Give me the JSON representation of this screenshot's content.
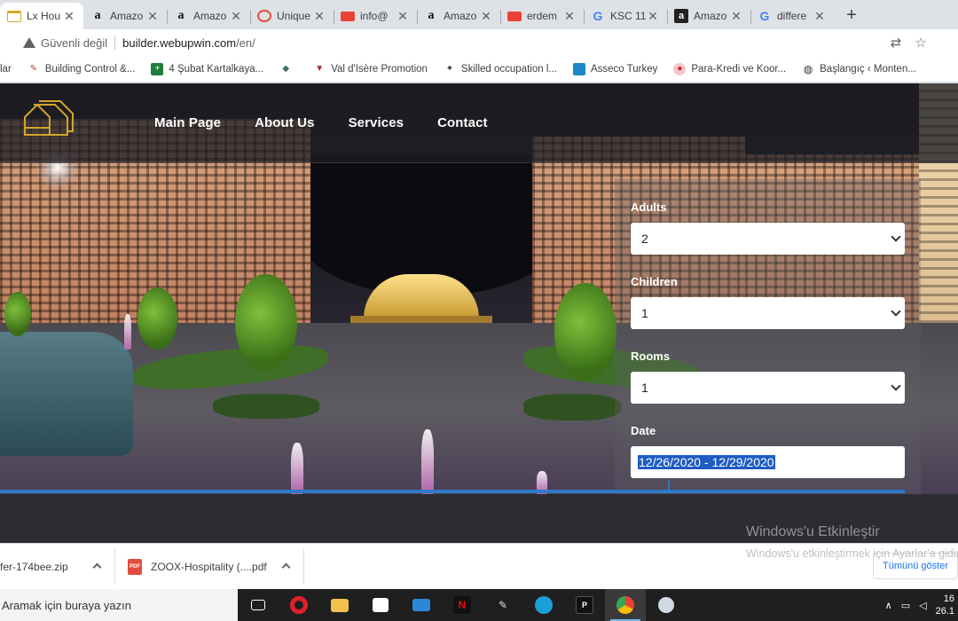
{
  "browser": {
    "tabs": [
      {
        "title": "Lx Hou",
        "icon": "house-icon",
        "active": true
      },
      {
        "title": "Amazo",
        "icon": "amazon-icon"
      },
      {
        "title": "Amazo",
        "icon": "amazon-icon"
      },
      {
        "title": "Unique",
        "icon": "unique-icon"
      },
      {
        "title": "info@",
        "icon": "gmail-icon"
      },
      {
        "title": "Amazo",
        "icon": "amazon-icon"
      },
      {
        "title": "erdem",
        "icon": "gmail-icon"
      },
      {
        "title": "KSC 11",
        "icon": "google-icon"
      },
      {
        "title": "Amazo",
        "icon": "amazon-dark-icon"
      },
      {
        "title": "differe",
        "icon": "google-icon"
      }
    ],
    "new_tab_label": "+",
    "security_label": "Güvenli değil",
    "url_host": "builder.webupwin.com",
    "url_path": "/en/",
    "bookmarks": [
      {
        "label": "lar",
        "icon": ""
      },
      {
        "label": "Building Control &...",
        "icon": "tool-icon"
      },
      {
        "label": "4 Şubat Kartalkaya...",
        "icon": "plus-icon"
      },
      {
        "label": "",
        "icon": "fish-icon"
      },
      {
        "label": "Val d'Isère Promotion",
        "icon": "emblem-icon"
      },
      {
        "label": "Skilled occupation l...",
        "icon": "worker-icon"
      },
      {
        "label": "Asseco Turkey",
        "icon": "asseco-icon"
      },
      {
        "label": "Para-Kredi ve Koor...",
        "icon": "coin-icon"
      },
      {
        "label": "Başlangıç ‹ Monten...",
        "icon": "globe-icon"
      }
    ]
  },
  "site": {
    "nav": [
      "Main Page",
      "About Us",
      "Services",
      "Contact"
    ],
    "booking": {
      "adults_label": "Adults",
      "adults_value": "2",
      "children_label": "Children",
      "children_value": "1",
      "rooms_label": "Rooms",
      "rooms_value": "1",
      "date_label": "Date",
      "date_value": "12/26/2020 - 12/29/2020"
    }
  },
  "overlay": {
    "activate_title": "Windows'u Etkinleştir",
    "activate_sub": "Windows'u etkinleştirmek için Ayarlar'a gidin."
  },
  "downloads": {
    "items": [
      {
        "name": "fer-174bee.zip"
      },
      {
        "name": "ZOOX-Hospitality (....pdf"
      }
    ],
    "show_all": "Tümünü göster"
  },
  "taskbar": {
    "search_placeholder": "Aramak için buraya yazın",
    "time": "16",
    "date": "26.1"
  },
  "colors": {
    "accent_blue": "#2f7ac8",
    "logo_gold": "#d3a62a",
    "date_highlight": "#1f5cc4"
  }
}
